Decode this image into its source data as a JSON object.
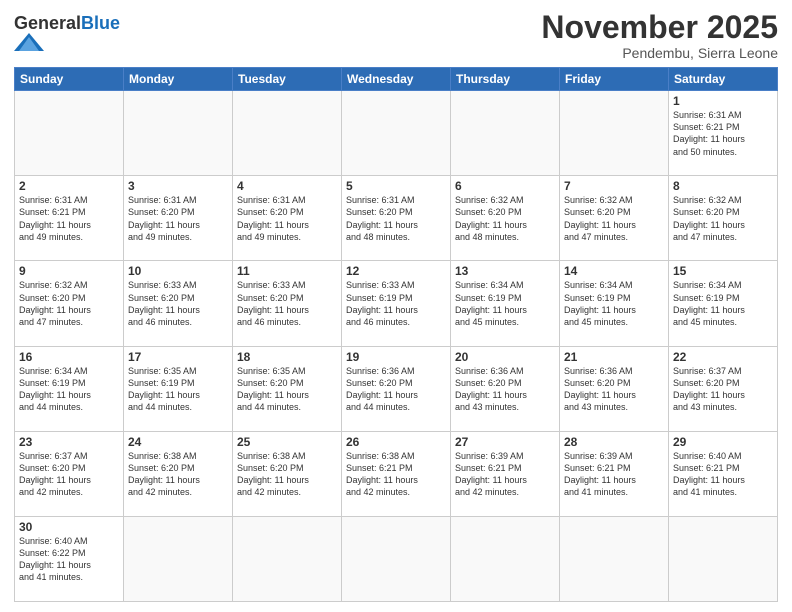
{
  "header": {
    "logo": {
      "general": "General",
      "blue": "Blue"
    },
    "title": "November 2025",
    "location": "Pendembu, Sierra Leone"
  },
  "weekdays": [
    "Sunday",
    "Monday",
    "Tuesday",
    "Wednesday",
    "Thursday",
    "Friday",
    "Saturday"
  ],
  "weeks": [
    [
      {
        "day": "",
        "info": ""
      },
      {
        "day": "",
        "info": ""
      },
      {
        "day": "",
        "info": ""
      },
      {
        "day": "",
        "info": ""
      },
      {
        "day": "",
        "info": ""
      },
      {
        "day": "",
        "info": ""
      },
      {
        "day": "1",
        "info": "Sunrise: 6:31 AM\nSunset: 6:21 PM\nDaylight: 11 hours\nand 50 minutes."
      }
    ],
    [
      {
        "day": "2",
        "info": "Sunrise: 6:31 AM\nSunset: 6:21 PM\nDaylight: 11 hours\nand 49 minutes."
      },
      {
        "day": "3",
        "info": "Sunrise: 6:31 AM\nSunset: 6:20 PM\nDaylight: 11 hours\nand 49 minutes."
      },
      {
        "day": "4",
        "info": "Sunrise: 6:31 AM\nSunset: 6:20 PM\nDaylight: 11 hours\nand 49 minutes."
      },
      {
        "day": "5",
        "info": "Sunrise: 6:31 AM\nSunset: 6:20 PM\nDaylight: 11 hours\nand 48 minutes."
      },
      {
        "day": "6",
        "info": "Sunrise: 6:32 AM\nSunset: 6:20 PM\nDaylight: 11 hours\nand 48 minutes."
      },
      {
        "day": "7",
        "info": "Sunrise: 6:32 AM\nSunset: 6:20 PM\nDaylight: 11 hours\nand 47 minutes."
      },
      {
        "day": "8",
        "info": "Sunrise: 6:32 AM\nSunset: 6:20 PM\nDaylight: 11 hours\nand 47 minutes."
      }
    ],
    [
      {
        "day": "9",
        "info": "Sunrise: 6:32 AM\nSunset: 6:20 PM\nDaylight: 11 hours\nand 47 minutes."
      },
      {
        "day": "10",
        "info": "Sunrise: 6:33 AM\nSunset: 6:20 PM\nDaylight: 11 hours\nand 46 minutes."
      },
      {
        "day": "11",
        "info": "Sunrise: 6:33 AM\nSunset: 6:20 PM\nDaylight: 11 hours\nand 46 minutes."
      },
      {
        "day": "12",
        "info": "Sunrise: 6:33 AM\nSunset: 6:19 PM\nDaylight: 11 hours\nand 46 minutes."
      },
      {
        "day": "13",
        "info": "Sunrise: 6:34 AM\nSunset: 6:19 PM\nDaylight: 11 hours\nand 45 minutes."
      },
      {
        "day": "14",
        "info": "Sunrise: 6:34 AM\nSunset: 6:19 PM\nDaylight: 11 hours\nand 45 minutes."
      },
      {
        "day": "15",
        "info": "Sunrise: 6:34 AM\nSunset: 6:19 PM\nDaylight: 11 hours\nand 45 minutes."
      }
    ],
    [
      {
        "day": "16",
        "info": "Sunrise: 6:34 AM\nSunset: 6:19 PM\nDaylight: 11 hours\nand 44 minutes."
      },
      {
        "day": "17",
        "info": "Sunrise: 6:35 AM\nSunset: 6:19 PM\nDaylight: 11 hours\nand 44 minutes."
      },
      {
        "day": "18",
        "info": "Sunrise: 6:35 AM\nSunset: 6:20 PM\nDaylight: 11 hours\nand 44 minutes."
      },
      {
        "day": "19",
        "info": "Sunrise: 6:36 AM\nSunset: 6:20 PM\nDaylight: 11 hours\nand 44 minutes."
      },
      {
        "day": "20",
        "info": "Sunrise: 6:36 AM\nSunset: 6:20 PM\nDaylight: 11 hours\nand 43 minutes."
      },
      {
        "day": "21",
        "info": "Sunrise: 6:36 AM\nSunset: 6:20 PM\nDaylight: 11 hours\nand 43 minutes."
      },
      {
        "day": "22",
        "info": "Sunrise: 6:37 AM\nSunset: 6:20 PM\nDaylight: 11 hours\nand 43 minutes."
      }
    ],
    [
      {
        "day": "23",
        "info": "Sunrise: 6:37 AM\nSunset: 6:20 PM\nDaylight: 11 hours\nand 42 minutes."
      },
      {
        "day": "24",
        "info": "Sunrise: 6:38 AM\nSunset: 6:20 PM\nDaylight: 11 hours\nand 42 minutes."
      },
      {
        "day": "25",
        "info": "Sunrise: 6:38 AM\nSunset: 6:20 PM\nDaylight: 11 hours\nand 42 minutes."
      },
      {
        "day": "26",
        "info": "Sunrise: 6:38 AM\nSunset: 6:21 PM\nDaylight: 11 hours\nand 42 minutes."
      },
      {
        "day": "27",
        "info": "Sunrise: 6:39 AM\nSunset: 6:21 PM\nDaylight: 11 hours\nand 42 minutes."
      },
      {
        "day": "28",
        "info": "Sunrise: 6:39 AM\nSunset: 6:21 PM\nDaylight: 11 hours\nand 41 minutes."
      },
      {
        "day": "29",
        "info": "Sunrise: 6:40 AM\nSunset: 6:21 PM\nDaylight: 11 hours\nand 41 minutes."
      }
    ],
    [
      {
        "day": "30",
        "info": "Sunrise: 6:40 AM\nSunset: 6:22 PM\nDaylight: 11 hours\nand 41 minutes."
      },
      {
        "day": "",
        "info": ""
      },
      {
        "day": "",
        "info": ""
      },
      {
        "day": "",
        "info": ""
      },
      {
        "day": "",
        "info": ""
      },
      {
        "day": "",
        "info": ""
      },
      {
        "day": "",
        "info": ""
      }
    ]
  ]
}
